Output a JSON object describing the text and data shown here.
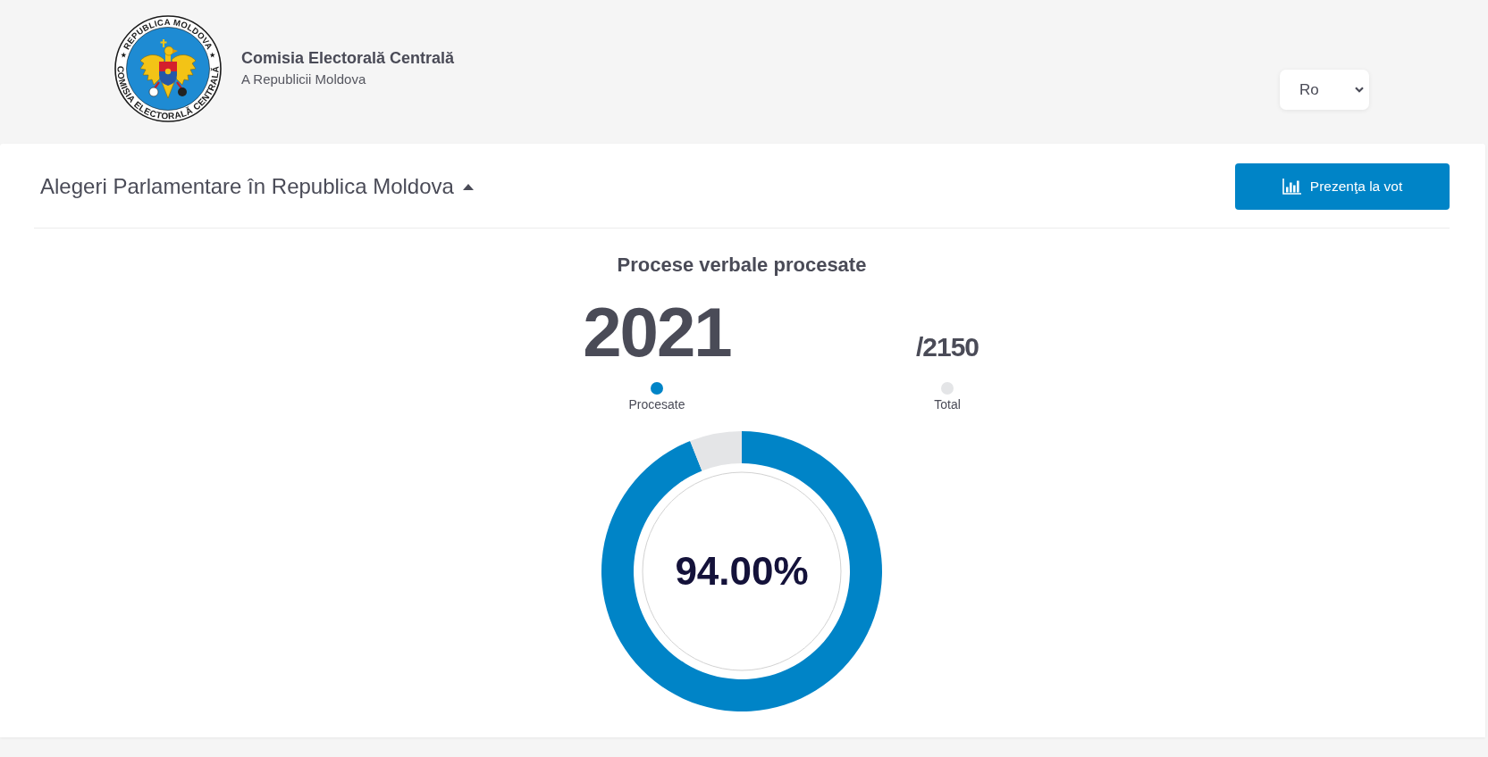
{
  "header": {
    "logo": {
      "top_text": "REPUBLICA MOLDOVA",
      "bottom_words": [
        "COMISIA",
        "ELECTORALĂ",
        "CENTRALĂ"
      ]
    },
    "title": "Comisia Electorală Centrală",
    "subtitle": "A Republicii Moldova",
    "language": {
      "value": "Ro"
    }
  },
  "election": {
    "title": "Alegeri Parlamentare în Republica Moldova",
    "button": "Prezenţa la vot"
  },
  "results": {
    "chart_data": {
      "type": "donut",
      "title": "Procese verbale procesate",
      "values": [
        94,
        6
      ]
    },
    "processed": "2021",
    "total": "/2150",
    "legend": [
      {
        "label": "Procesate",
        "color": "#0084c7"
      },
      {
        "label": "Total",
        "color": "#e4e5e7"
      }
    ],
    "percent": "94.00%"
  }
}
